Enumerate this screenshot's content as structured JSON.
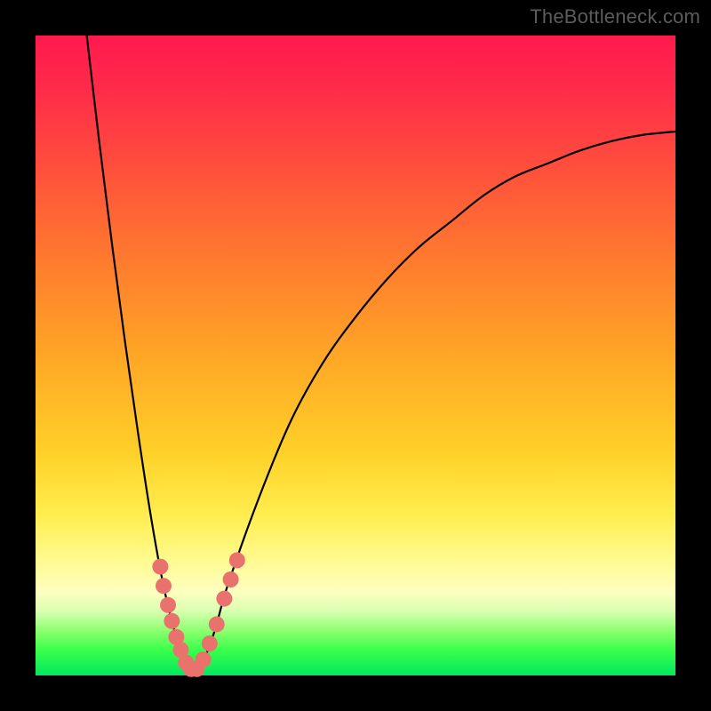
{
  "watermark": "TheBottleneck.com",
  "chart_data": {
    "type": "line",
    "title": "",
    "xlabel": "",
    "ylabel": "",
    "xlim": [
      0,
      100
    ],
    "ylim": [
      0,
      100
    ],
    "series": [
      {
        "name": "bottleneck-curve",
        "x": [
          8,
          10,
          12,
          14,
          16,
          18,
          20,
          22,
          24,
          26,
          28,
          30,
          35,
          40,
          45,
          50,
          55,
          60,
          65,
          70,
          75,
          80,
          85,
          90,
          95,
          100
        ],
        "values": [
          100,
          83,
          67,
          52,
          38,
          25,
          14,
          6,
          1,
          2,
          7,
          14,
          28,
          40,
          49,
          56,
          62,
          67,
          71,
          75,
          78,
          80,
          82,
          83.5,
          84.5,
          85
        ]
      }
    ],
    "markers": {
      "name": "highlighted-points",
      "color": "#e9736c",
      "points": [
        {
          "x": 19.5,
          "y": 17
        },
        {
          "x": 20.0,
          "y": 14
        },
        {
          "x": 20.7,
          "y": 11
        },
        {
          "x": 21.3,
          "y": 8.5
        },
        {
          "x": 22.0,
          "y": 6
        },
        {
          "x": 22.7,
          "y": 4
        },
        {
          "x": 23.5,
          "y": 2
        },
        {
          "x": 24.3,
          "y": 1
        },
        {
          "x": 25.2,
          "y": 1
        },
        {
          "x": 26.2,
          "y": 2.5
        },
        {
          "x": 27.2,
          "y": 5
        },
        {
          "x": 28.3,
          "y": 8
        },
        {
          "x": 29.5,
          "y": 12
        },
        {
          "x": 30.5,
          "y": 15
        },
        {
          "x": 31.5,
          "y": 18
        }
      ]
    }
  }
}
